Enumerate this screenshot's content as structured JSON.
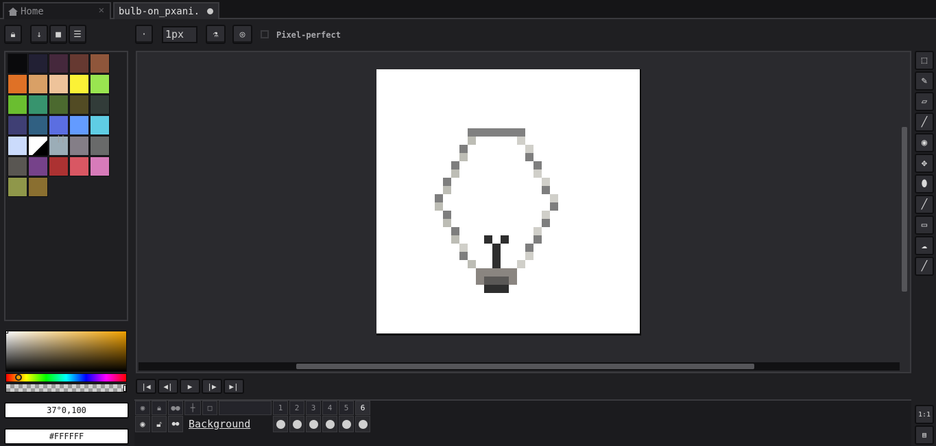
{
  "tabs": [
    {
      "label": "Home",
      "active": false,
      "closable": true
    },
    {
      "label": "bulb-on_pxani.",
      "active": true,
      "modified": true
    }
  ],
  "toolbar": {
    "left_icons": [
      "lock-icon",
      "download-icon",
      "new-sprite-icon",
      "menu-icon"
    ],
    "brush_shape_icon": "dot-icon",
    "brush_size": "1px",
    "ink_icon": "ink-bottle-icon",
    "symmetry_icon": "symmetry-icon",
    "pixel_perfect_label": "Pixel-perfect",
    "pixel_perfect_checked": false
  },
  "palette": {
    "colors": [
      "#0a0a0c",
      "#222034",
      "#45283c",
      "#663931",
      "#8f563b",
      "#df7126",
      "#d9a066",
      "#eec39a",
      "#fbf236",
      "#99e550",
      "#6abe30",
      "#37946e",
      "#4b692f",
      "#524b24",
      "#323c39",
      "#3f3f74",
      "#306082",
      "#5b6ee1",
      "#639bff",
      "#5fcde4",
      "#cbdbfc",
      "#ffffff",
      "#9badb7",
      "#847e87",
      "#696a6a",
      "#595652",
      "#76428a",
      "#ac3232",
      "#d95763",
      "#d77bba",
      "#8f974a",
      "#8a6f30"
    ],
    "separator": "||"
  },
  "color": {
    "hsv_text": "37°0,100",
    "hex_text": "#FFFFFF"
  },
  "timeline": {
    "frames": [
      "1",
      "2",
      "3",
      "4",
      "5",
      "6"
    ],
    "current_frame": "6",
    "layers": [
      {
        "name": "Background",
        "visible": true,
        "editable": true
      }
    ]
  },
  "right_tools": [
    "marquee-icon",
    "pencil-icon",
    "eraser-icon",
    "spray-icon",
    "eyedropper-icon",
    "move-icon",
    "paint-bucket-icon",
    "line-icon",
    "rectangle-icon",
    "lasso-icon",
    "blur-icon"
  ],
  "bottom_right": {
    "zoom_reset": "1:1",
    "film_icon": "filmstrip-icon"
  }
}
